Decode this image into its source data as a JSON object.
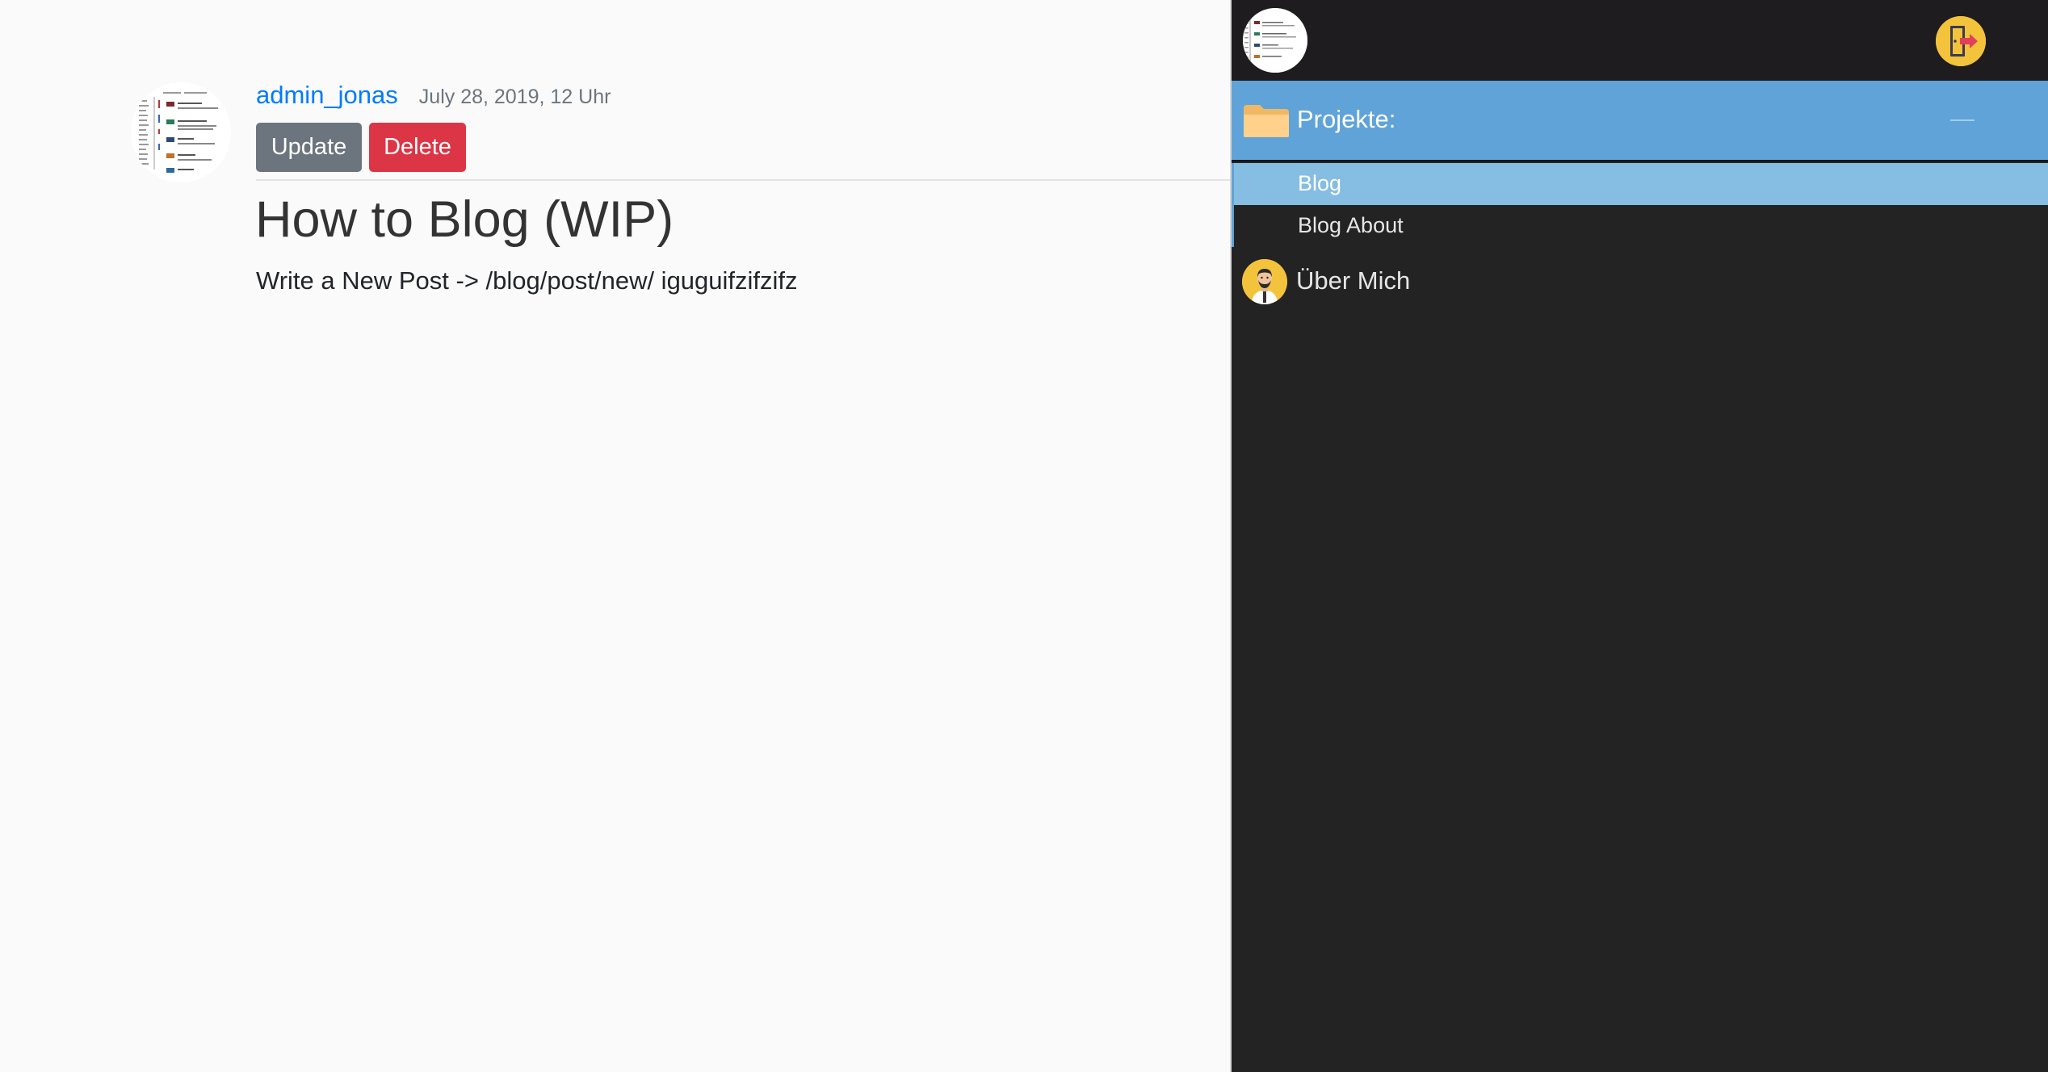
{
  "post": {
    "author": "admin_jonas",
    "date": "July 28, 2019, 12 Uhr",
    "update_label": "Update",
    "delete_label": "Delete",
    "title": "How to Blog (WIP)",
    "content": "Write a New Post -> /blog/post/new/ iguguifzifzifz"
  },
  "sidebar": {
    "projects_label": "Projekte:",
    "projects_items": [
      {
        "label": "Blog",
        "active": true
      },
      {
        "label": "Blog About",
        "active": false
      }
    ],
    "about_label": "Über Mich"
  },
  "icons": {
    "avatar": "profile-image-icon",
    "logout": "logout-door-icon",
    "folder": "folder-icon",
    "collapse": "collapse-minus-icon",
    "about": "person-avatar-icon"
  },
  "colors": {
    "link": "#007bff",
    "update_button": "#6c757d",
    "delete_button": "#dc3545",
    "sidebar_bg": "#232323",
    "projects_header": "#5fa3d8",
    "active_item": "#86bde2",
    "accent_yellow": "#f3c33c"
  }
}
